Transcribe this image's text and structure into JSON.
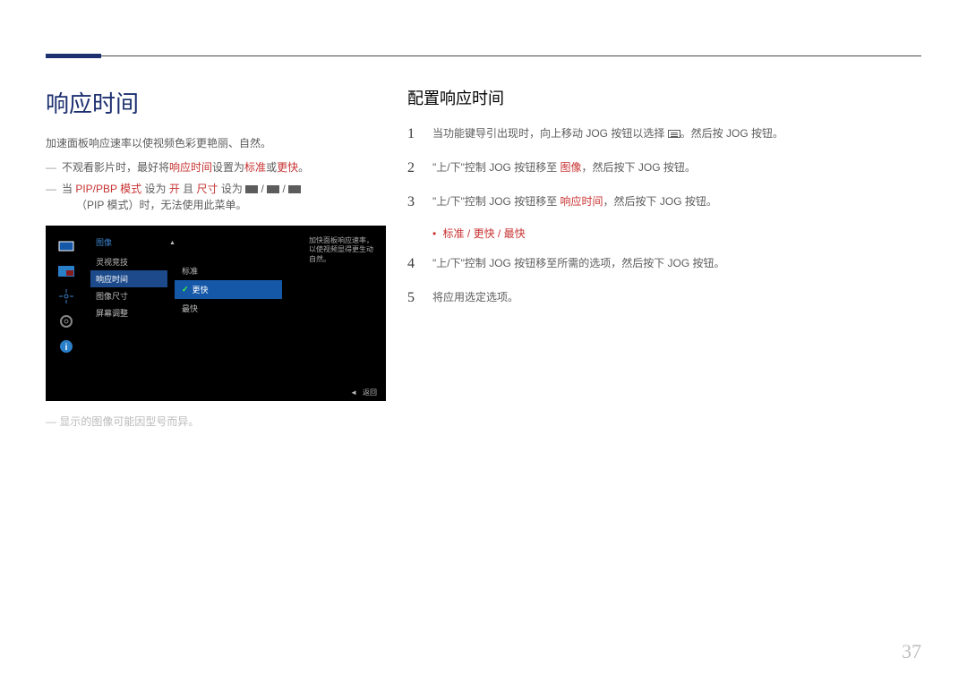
{
  "left": {
    "title": "响应时间",
    "desc": "加速面板响应速率以使视频色彩更艳丽、自然。",
    "dash1_a": "不观看影片时，最好将",
    "dash1_b": "响应时间",
    "dash1_c": "设置为",
    "dash1_d": "标准",
    "dash1_e": "或",
    "dash1_f": "更快",
    "dash1_g": "。",
    "dash2_a": "当 ",
    "dash2_b": "PIP/PBP 模式",
    "dash2_c": " 设为 ",
    "dash2_d": "开",
    "dash2_e": " 且 ",
    "dash2_f": "尺寸",
    "dash2_g": " 设为 ",
    "dash2_h": " / ",
    "dash2_i": " / ",
    "dash2_j": "（PIP 模式）时，无法使用此菜单。",
    "screenshot": {
      "menu_title": "图像",
      "menu_items": [
        "灵视竞技",
        "响应时间",
        "图像尺寸",
        "屏幕调整"
      ],
      "options": [
        "标准",
        "更快",
        "最快"
      ],
      "side_desc": "加快面板响应速率，以使视频显得更生动自然。",
      "back": "返回"
    },
    "footnote": "显示的图像可能因型号而异。"
  },
  "right": {
    "title": "配置响应时间",
    "step1_a": "当功能键导引出现时，向上移动 JOG 按钮以选择 ",
    "step1_b": "。然后按 JOG 按钮。",
    "step2_a": "\"上/下\"控制 JOG 按钮移至 ",
    "step2_b": "图像",
    "step2_c": "，然后按下 JOG 按钮。",
    "step3_a": "\"上/下\"控制 JOG 按钮移至 ",
    "step3_b": "响应时间",
    "step3_c": "，然后按下 JOG 按钮。",
    "bullet_a": "标准",
    "bullet_sep": " / ",
    "bullet_b": "更快",
    "bullet_c": "最快",
    "step4": "\"上/下\"控制 JOG 按钮移至所需的选项，然后按下 JOG 按钮。",
    "step5": "将应用选定选项。"
  },
  "pageNum": "37"
}
